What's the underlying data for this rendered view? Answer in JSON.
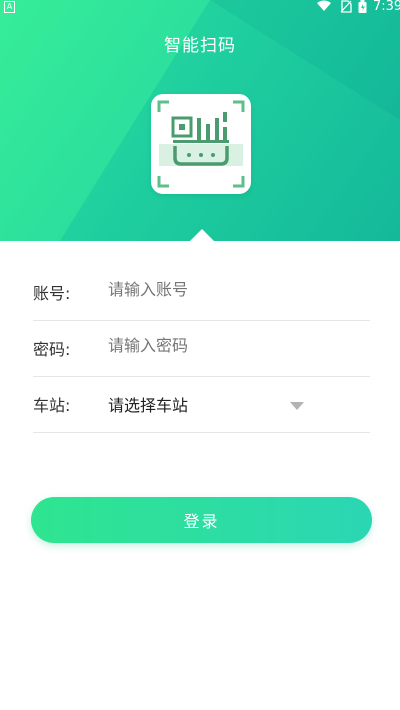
{
  "status_bar": {
    "app_indicator": "A",
    "wifi_icon": "wifi-icon",
    "sim_icon": "no-sim-icon",
    "battery_icon": "battery-icon",
    "time": "7:39"
  },
  "header": {
    "title": "智能扫码",
    "logo_icon": "qr-scan-icon"
  },
  "form": {
    "account": {
      "label": "账号:",
      "placeholder": "请输入账号",
      "value": ""
    },
    "password": {
      "label": "密码:",
      "placeholder": "请输入密码",
      "value": ""
    },
    "station": {
      "label": "车站:",
      "selected": "请选择车站",
      "dropdown_icon": "triangle-down-icon"
    }
  },
  "login_button": {
    "label": "登录"
  },
  "colors": {
    "gradient_start": "#34ec97",
    "gradient_end": "#13b59a",
    "button_start": "#2fe58f",
    "button_end": "#2bd6b4",
    "text_dark": "#333333",
    "placeholder": "#b8b8b8"
  }
}
